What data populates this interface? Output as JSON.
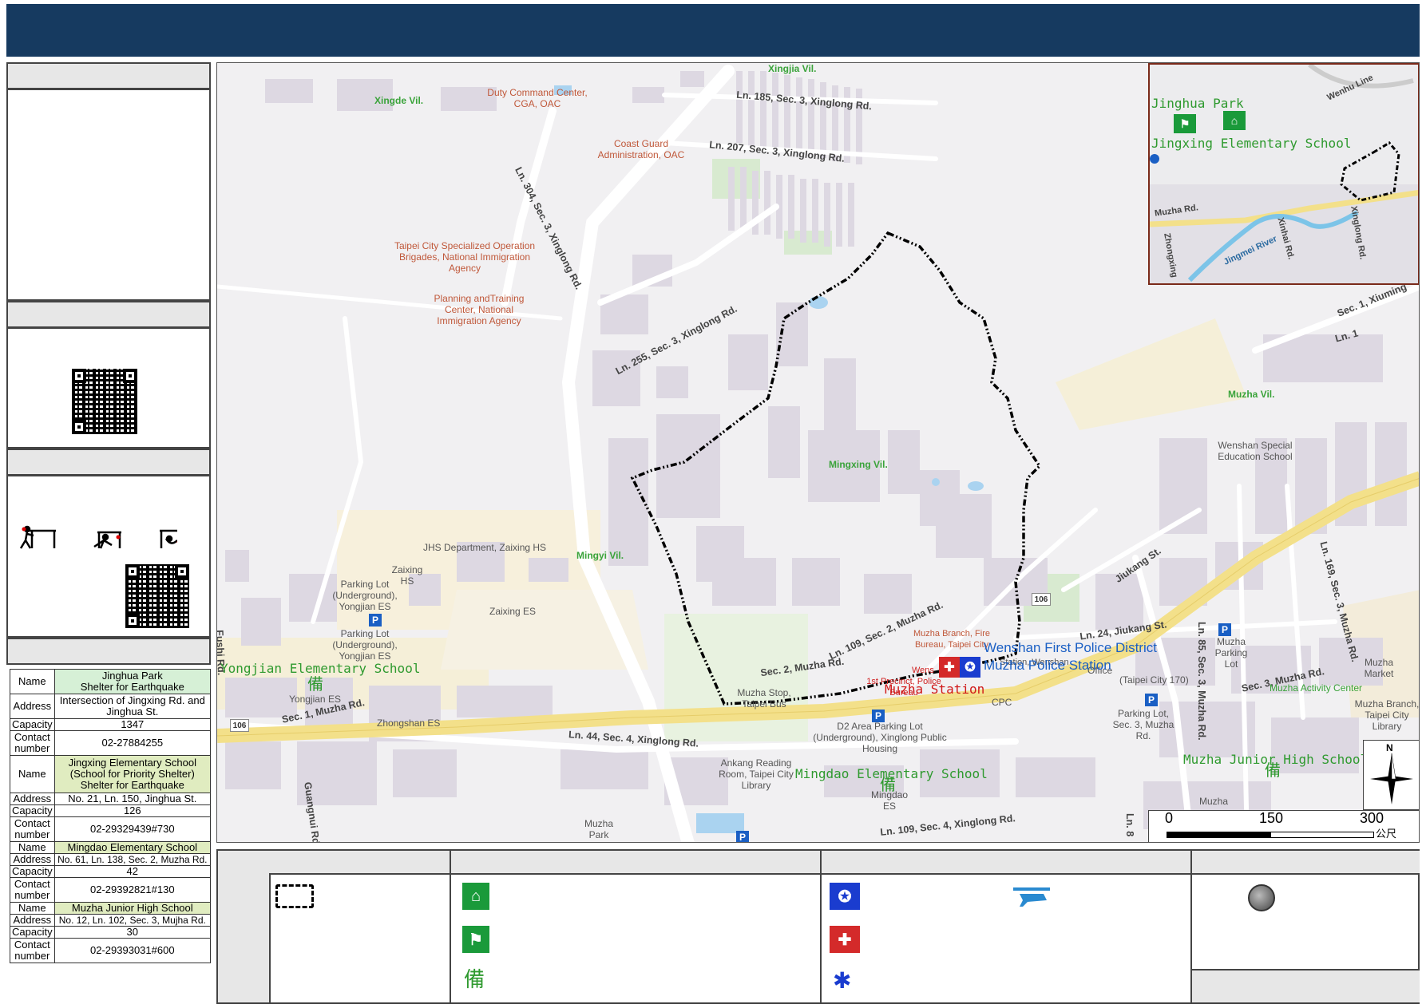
{
  "colors": {
    "header_bar": "#163a60",
    "shelter_green": "#1a9a3a",
    "police_blue": "#1a3ccf",
    "fire_red": "#d42a2a",
    "boundary": "#000000",
    "main_road": "#f3e08a"
  },
  "sidebar": {
    "shelters": [
      {
        "name_label": "Name",
        "name": "Jinghua Park\nShelter for Earthquake",
        "address_label": "Address",
        "address": "Intersection of Jingxing Rd. and Jinghua St.",
        "capacity_label": "Capacity",
        "capacity": "1347",
        "contact_label": "Contact number",
        "contact": "02-27884255"
      },
      {
        "name_label": "Name",
        "name": "Jingxing Elementary School (School for Priority Shelter) Shelter for Earthquake",
        "address_label": "Address",
        "address": "No. 21, Ln. 150, Jinghua St.",
        "capacity_label": "Capacity",
        "capacity": "126",
        "contact_label": "Contact number",
        "contact": "02-29329439#730"
      },
      {
        "name_label": "Name",
        "name": "Mingdao Elementary School",
        "address_label": "Address",
        "address": "No. 61, Ln. 138, Sec. 2, Muzha Rd.",
        "capacity_label": "Capacity",
        "capacity": "42",
        "contact_label": "Contact number",
        "contact": "02-29392821#130"
      },
      {
        "name_label": "Name",
        "name": "Muzha Junior High School",
        "address_label": "Address",
        "address": "No. 12, Ln. 102, Sec. 3, Mujha Rd.",
        "capacity_label": "Capacity",
        "capacity": "30",
        "contact_label": "Contact number",
        "contact": "02-29393031#600"
      }
    ]
  },
  "map": {
    "villages": [
      "Xingjia Vil.",
      "Xingde Vil.",
      "Muzha Vil.",
      "Mingxing Vil.",
      "Mingyi Vil."
    ],
    "roads": [
      "Ln. 185, Sec. 3, Xinglong Rd.",
      "Ln. 207, Sec. 3, Xinglong Rd.",
      "Ln. 304, Sec. 3, Xinglong Rd.",
      "Ln. 255, Sec. 3, Xinglong Rd.",
      "Sec. 1, Xiuming",
      "Ln. 109, Sec. 2, Muzha Rd.",
      "Sec. 2, Muzha Rd.",
      "Sec. 1, Muzha Rd.",
      "Jiukang St.",
      "Ln. 24, Jiukang St.",
      "Ln. 85, Sec. 3, Muzha Rd.",
      "Ln. 169, Sec. 3, Muzha Rd.",
      "Sec. 3, Muzha Rd.",
      "Ln. 44, Sec. 4, Xinglong Rd.",
      "Ln. 109, Sec. 4, Xinglong Rd.",
      "Fushi Rd.",
      "Guangnui Rd.",
      "Ln. 8",
      "Ln. 1"
    ],
    "government": [
      "Duty Command Center, CGA, OAC",
      "Coast Guard Administration, OAC",
      "Taipei City Specialized Operation Brigades, National Immigration Agency",
      "Planning andTraining Center, National Immigration Agency",
      "Muzha Branch, Fire Bureau, Taipei City",
      "1st Precinct, Police Bureau"
    ],
    "pois": [
      "JHS Department, Zaixing HS",
      "Zaixing HS",
      "Parking Lot (Underground), Yongjian ES",
      "Parking Lot (Underground), Yongjian ES",
      "Zaixing ES",
      "Zhongshan ES",
      "Yongjian ES",
      "Muzha Stop, Taipei Bus",
      "CPC",
      "D2 Area Parking Lot (Underground), Xinglong Public Housing",
      "Ankang Reading Room, Taipei City Library",
      "Mingdao ES",
      "Muzha Park",
      "Wenshan Special Education School",
      "Muzha Parking Lot",
      "Parking Lot, Sec. 3, Muzha Rd.",
      "Muzha Market",
      "Muzha Activity Center",
      "Muzha Branch, Taipei City Library",
      "Muzha",
      "Station, Wenshan",
      "Wens",
      "(Taipei City 170)",
      "Office"
    ],
    "shelter_labels": [
      "Yongjian Elementary School",
      "Mingdao Elementary School",
      "Muzha Junior High School"
    ],
    "police_labels": [
      "Wenshan First Police District",
      "Muzha Police Station"
    ],
    "fire_label": "Muzha Station",
    "route_badge": "106",
    "parking_letter": "P",
    "shelter_glyph": "備"
  },
  "inset": {
    "labels": [
      "Jinghua Park",
      "Jingxing Elementary School",
      "Muzha Rd.",
      "Zhongxing",
      "Jingmei River",
      "Xinhai Rd.",
      "Xinglong Rd.",
      "Wenhu Line"
    ]
  },
  "scale": {
    "ticks": [
      "0",
      "150",
      "300"
    ],
    "unit": "公尺"
  },
  "compass": {
    "north": "N"
  }
}
